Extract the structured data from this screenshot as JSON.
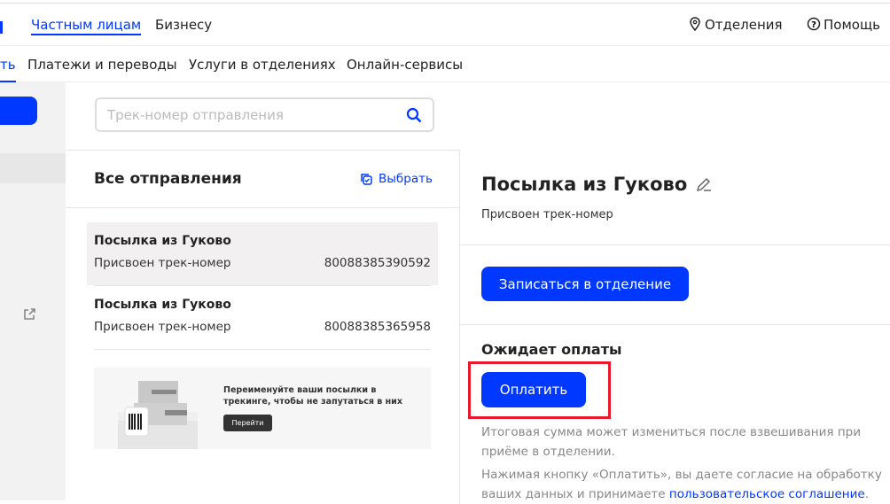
{
  "nav_top": {
    "private": "Частным лицам",
    "business": "Бизнесу",
    "offices": "Отделения",
    "help": "Помощь"
  },
  "nav_main": {
    "partial": "ть",
    "items": [
      "Платежи и переводы",
      "Услуги в отделениях",
      "Онлайн-сервисы"
    ]
  },
  "search": {
    "placeholder": "Трек-номер отправления"
  },
  "list": {
    "title": "Все отправления",
    "select": "Выбрать",
    "items": [
      {
        "title": "Посылка из Гуково",
        "status": "Присвоен трек-номер",
        "track": "80088385390592"
      },
      {
        "title": "Посылка из Гуково",
        "status": "Присвоен трек-номер",
        "track": "80088385365958"
      }
    ]
  },
  "banner": {
    "text": "Переименуйте ваши посылки в трекинге, чтобы не запутаться в них",
    "button": "Перейти"
  },
  "detail": {
    "title": "Посылка из Гуково",
    "status": "Присвоен трек-номер",
    "book_button": "Записаться в отделение",
    "payment_title": "Ожидает оплаты",
    "pay_button": "Оплатить",
    "note1": "Итоговая сумма может измениться после взвешивания при приёме в отделении.",
    "note2_prefix": "Нажимая кнопку «Оплатить», вы даете согласие на обработку ваших данных и принимаете ",
    "note2_link": "пользовательское соглашение",
    "note2_suffix": "."
  },
  "colors": {
    "accent": "#0038ff",
    "highlight": "#e8192c"
  }
}
